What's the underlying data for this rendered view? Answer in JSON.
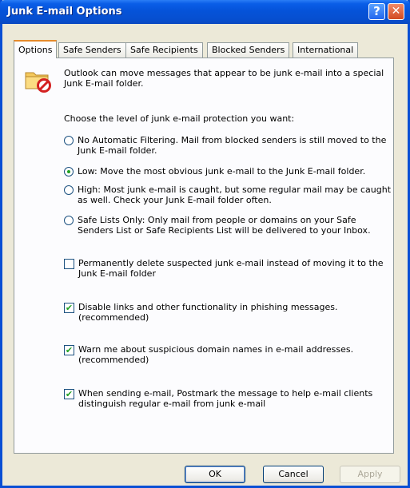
{
  "window": {
    "title": "Junk E-mail Options",
    "help_glyph": "?",
    "close_glyph": "✕"
  },
  "tabs": [
    {
      "label": "Options",
      "active": true
    },
    {
      "label": "Safe Senders",
      "active": false
    },
    {
      "label": "Safe Recipients",
      "active": false
    },
    {
      "label": "Blocked Senders",
      "active": false
    },
    {
      "label": "International",
      "active": false
    }
  ],
  "options_tab": {
    "intro_line1": "Outlook can move messages that appear to be junk e-mail into a special",
    "intro_line2": "Junk E-mail folder.",
    "level_prompt": "Choose the level of junk e-mail protection you want:",
    "levels": [
      {
        "line1": "No Automatic Filtering. Mail from blocked senders is still moved to the",
        "line2": "Junk E-mail folder.",
        "selected": false
      },
      {
        "line1": "Low: Move the most obvious junk e-mail to the Junk E-mail folder.",
        "line2": "",
        "selected": true
      },
      {
        "line1": "High: Most junk e-mail is caught, but some regular mail may be caught",
        "line2": "as well. Check your Junk E-mail folder often.",
        "selected": false
      },
      {
        "line1": "Safe Lists Only: Only mail from people or domains on your Safe",
        "line2": "Senders List or Safe Recipients List will be delivered to your Inbox.",
        "selected": false
      }
    ],
    "checkboxes": [
      {
        "line1": "Permanently delete suspected junk e-mail instead of moving it to the",
        "line2": "Junk E-mail folder",
        "checked": false
      },
      {
        "line1": "Disable links and other functionality in phishing messages.",
        "line2": "(recommended)",
        "checked": true
      },
      {
        "line1": "Warn me about suspicious domain names in e-mail addresses.",
        "line2": "(recommended)",
        "checked": true
      },
      {
        "line1": "When sending e-mail, Postmark the message to help e-mail clients",
        "line2": "distinguish regular e-mail from junk e-mail",
        "checked": true
      }
    ],
    "check_glyph": "✔",
    "icon": "junk-folder-icon"
  },
  "buttons": {
    "ok": "OK",
    "cancel": "Cancel",
    "apply": "Apply"
  },
  "colors": {
    "titlebar": "#0553d9",
    "active_tab_accent": "#e68b2c",
    "dialog_bg": "#ece9d8",
    "check_green": "#21a121"
  }
}
